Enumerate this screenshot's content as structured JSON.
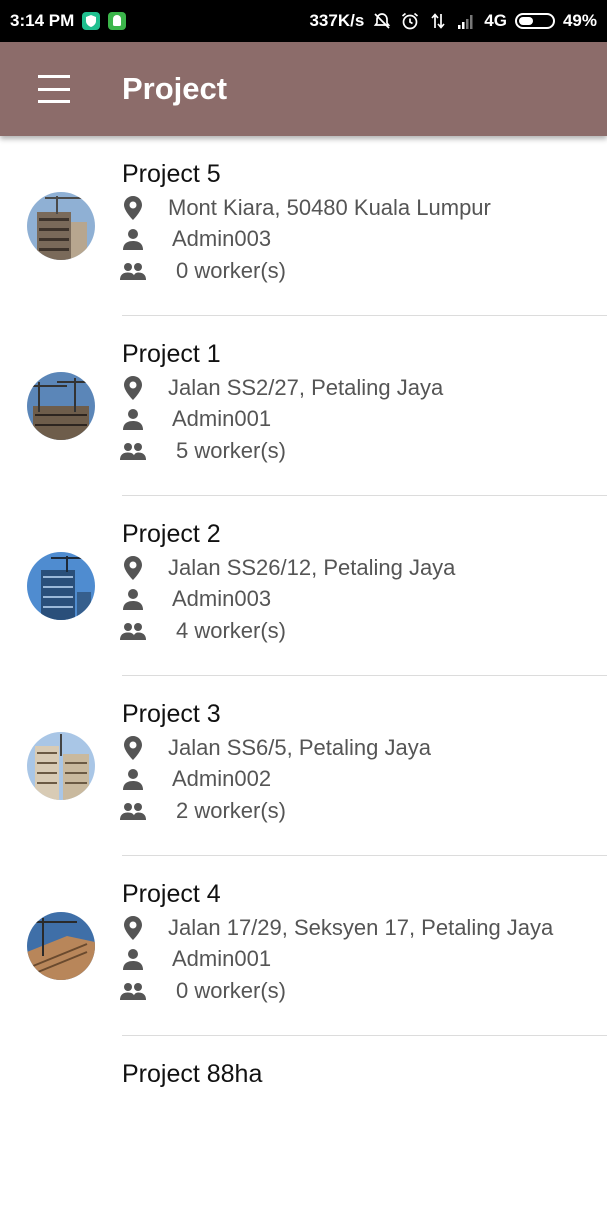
{
  "status_bar": {
    "time": "3:14 PM",
    "network_speed": "337K/s",
    "network_type": "4G",
    "battery": "49%",
    "battery_level": 0.49
  },
  "app_bar": {
    "title": "Project"
  },
  "projects": [
    {
      "name": "Project 5",
      "location": "Mont Kiara, 50480 Kuala Lumpur",
      "admin": "Admin003",
      "workers": "0 worker(s)"
    },
    {
      "name": "Project 1",
      "location": "Jalan SS2/27, Petaling Jaya",
      "admin": "Admin001",
      "workers": "5 worker(s)"
    },
    {
      "name": "Project 2",
      "location": "Jalan SS26/12, Petaling Jaya",
      "admin": "Admin003",
      "workers": "4 worker(s)"
    },
    {
      "name": "Project 3",
      "location": "Jalan SS6/5, Petaling Jaya",
      "admin": "Admin002",
      "workers": "2 worker(s)"
    },
    {
      "name": "Project 4",
      "location": "Jalan 17/29, Seksyen 17, Petaling Jaya",
      "admin": "Admin001",
      "workers": "0 worker(s)"
    },
    {
      "name": "Project 88ha",
      "location": "",
      "admin": "",
      "workers": ""
    }
  ],
  "icons": {
    "location": "location-pin-icon",
    "admin": "person-icon",
    "workers": "people-icon"
  },
  "colors": {
    "app_bar": "#8c6c6a",
    "status_bar": "#000000",
    "secondary_text": "#555555"
  }
}
